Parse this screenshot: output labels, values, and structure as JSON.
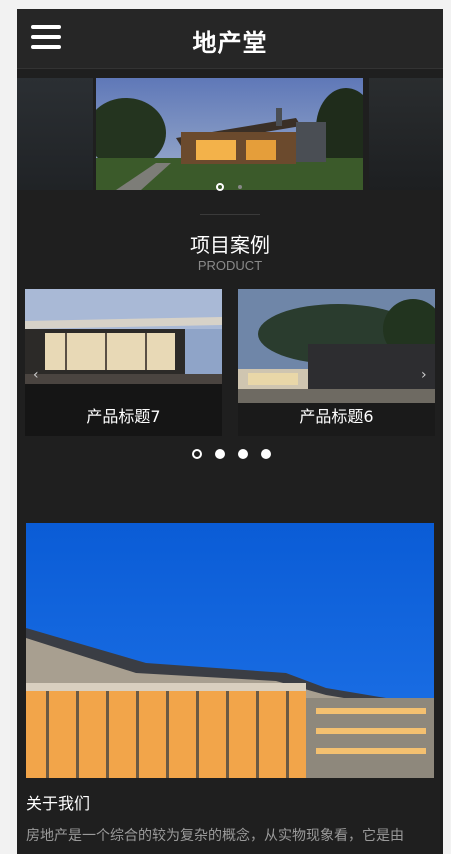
{
  "header": {
    "logo": "地产堂",
    "menu_icon": "hamburger-menu-icon"
  },
  "hero_slider": {
    "active_index": 0,
    "dot_count": 2
  },
  "section": {
    "title": "项目案例",
    "subtitle": "PRODUCT"
  },
  "products": [
    {
      "label": "产品标题7"
    },
    {
      "label": "产品标题6"
    }
  ],
  "carousel": {
    "active_index": 0,
    "dot_count": 4
  },
  "about": {
    "title": "关于我们",
    "text": "房地产是一个综合的较为复杂的概念，从实物现象看，它是由"
  },
  "colors": {
    "page_bg": "#1f1f1f",
    "header_bg": "#262626",
    "accent_sky": "#0a5cd6"
  }
}
